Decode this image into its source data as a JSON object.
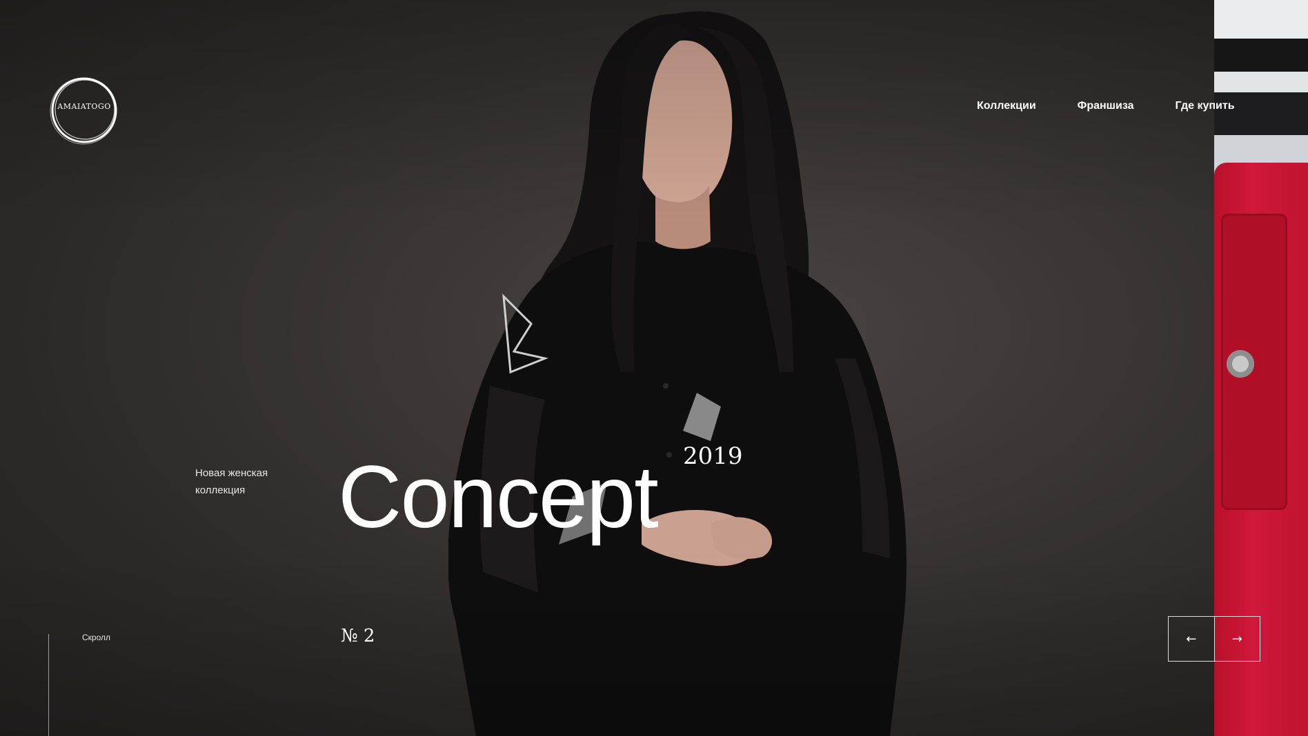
{
  "brand": {
    "logo_text": "AMAIATOGO"
  },
  "nav": {
    "items": [
      {
        "label": "Коллекции"
      },
      {
        "label": "Франшиза"
      },
      {
        "label": "Где купить"
      }
    ]
  },
  "hero": {
    "subtitle_line1": "Новая женская",
    "subtitle_line2": "коллекция",
    "title": "Concept",
    "year": "2019",
    "number": "№ 2",
    "scroll_label": "Скролл"
  },
  "slider": {
    "prev_icon": "arrow-left-icon",
    "next_icon": "arrow-right-icon",
    "prev_glyph": "←",
    "next_glyph": "→"
  },
  "colors": {
    "background": "#2b2727",
    "accent_red": "#c01430",
    "text": "#ffffff"
  }
}
